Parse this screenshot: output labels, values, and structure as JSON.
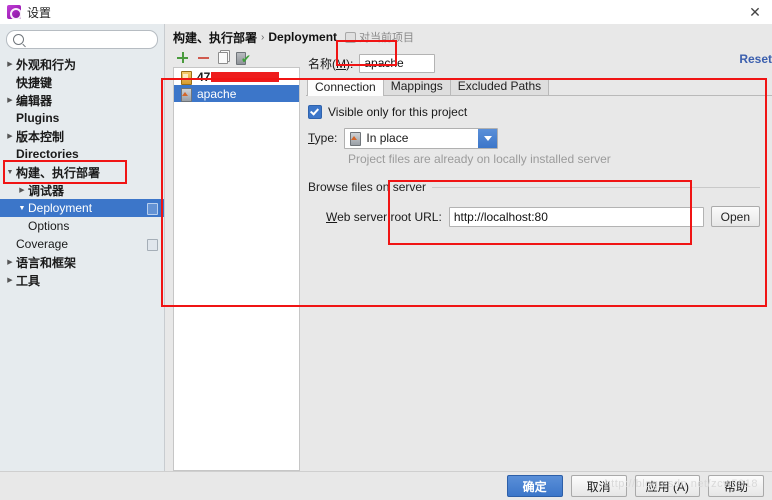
{
  "window": {
    "title": "设置",
    "close_label": "✕",
    "app_icon": "settings-gear-icon"
  },
  "sidebar": {
    "search": {
      "value": "",
      "placeholder": "",
      "icon": "search-icon"
    },
    "items": [
      {
        "label": "外观和行为",
        "arrow": "▶",
        "level": 0,
        "selected": false
      },
      {
        "label": "快捷键",
        "arrow": "",
        "level": 1,
        "selected": false
      },
      {
        "label": "编辑器",
        "arrow": "▶",
        "level": 0,
        "selected": false
      },
      {
        "label": "Plugins",
        "arrow": "",
        "level": 1,
        "selected": false
      },
      {
        "label": "版本控制",
        "arrow": "▶",
        "level": 0,
        "selected": false
      },
      {
        "label": "Directories",
        "arrow": "",
        "level": 1,
        "selected": false
      },
      {
        "label": "构建、执行部署",
        "arrow": "▼",
        "level": 0,
        "selected": false
      },
      {
        "label": "调试器",
        "arrow": "▶",
        "level": 1,
        "selected": false
      },
      {
        "label": "Deployment",
        "arrow": "▼",
        "level": 1,
        "selected": true
      },
      {
        "label": "Options",
        "arrow": "",
        "level": 2,
        "selected": false
      },
      {
        "label": "Coverage",
        "arrow": "",
        "level": 1,
        "selected": false
      },
      {
        "label": "语言和框架",
        "arrow": "▶",
        "level": 0,
        "selected": false
      },
      {
        "label": "工具",
        "arrow": "▶",
        "level": 0,
        "selected": false
      }
    ]
  },
  "breadcrumb": {
    "root": "构建、执行部署",
    "separator": "›",
    "current": "Deployment",
    "project_scope": "对当前项目",
    "project_scope_icon": "project-scope-icon"
  },
  "reset": {
    "label": "Reset"
  },
  "server_toolbar": {
    "add_icon": "plus-icon",
    "remove_icon": "minus-icon",
    "copy_icon": "copy-icon",
    "set_default_icon": "server-check-icon"
  },
  "server_list": [
    {
      "name": "47",
      "redacted": true,
      "icon": "ftp-server-icon",
      "selected": false
    },
    {
      "name": "apache",
      "redacted": false,
      "icon": "local-server-icon",
      "selected": true
    }
  ],
  "name_field": {
    "label_prefix": "名称(",
    "label_mnemonic": "M",
    "label_suffix": "):",
    "value": "apache",
    "placeholder": ""
  },
  "tabs": [
    {
      "label": "Connection",
      "active": true
    },
    {
      "label": "Mappings",
      "active": false
    },
    {
      "label": "Excluded Paths",
      "active": false
    }
  ],
  "connection": {
    "visible_only_checkbox": {
      "label": "Visible only for this project",
      "checked": true
    },
    "type_label_prefix": "T",
    "type_label_suffix": "ype:",
    "type_value": "In place",
    "type_icon": "local-server-icon",
    "type_hint": "Project files are already on locally installed server",
    "browse_group_title": "Browse files on server",
    "url_label_mnemonic": "W",
    "url_label_rest": "eb server root URL:",
    "url_value": "http://localhost:80",
    "open_button": "Open"
  },
  "footer": {
    "ok": "确定",
    "cancel": "取消",
    "apply": "应用 (A)",
    "help": "帮助",
    "watermark": "http://blog.csdn.net/zcw5018"
  },
  "colors": {
    "accent_blue": "#3c76c9",
    "annotation_red": "#f01414",
    "link_blue": "#3b5fae"
  }
}
